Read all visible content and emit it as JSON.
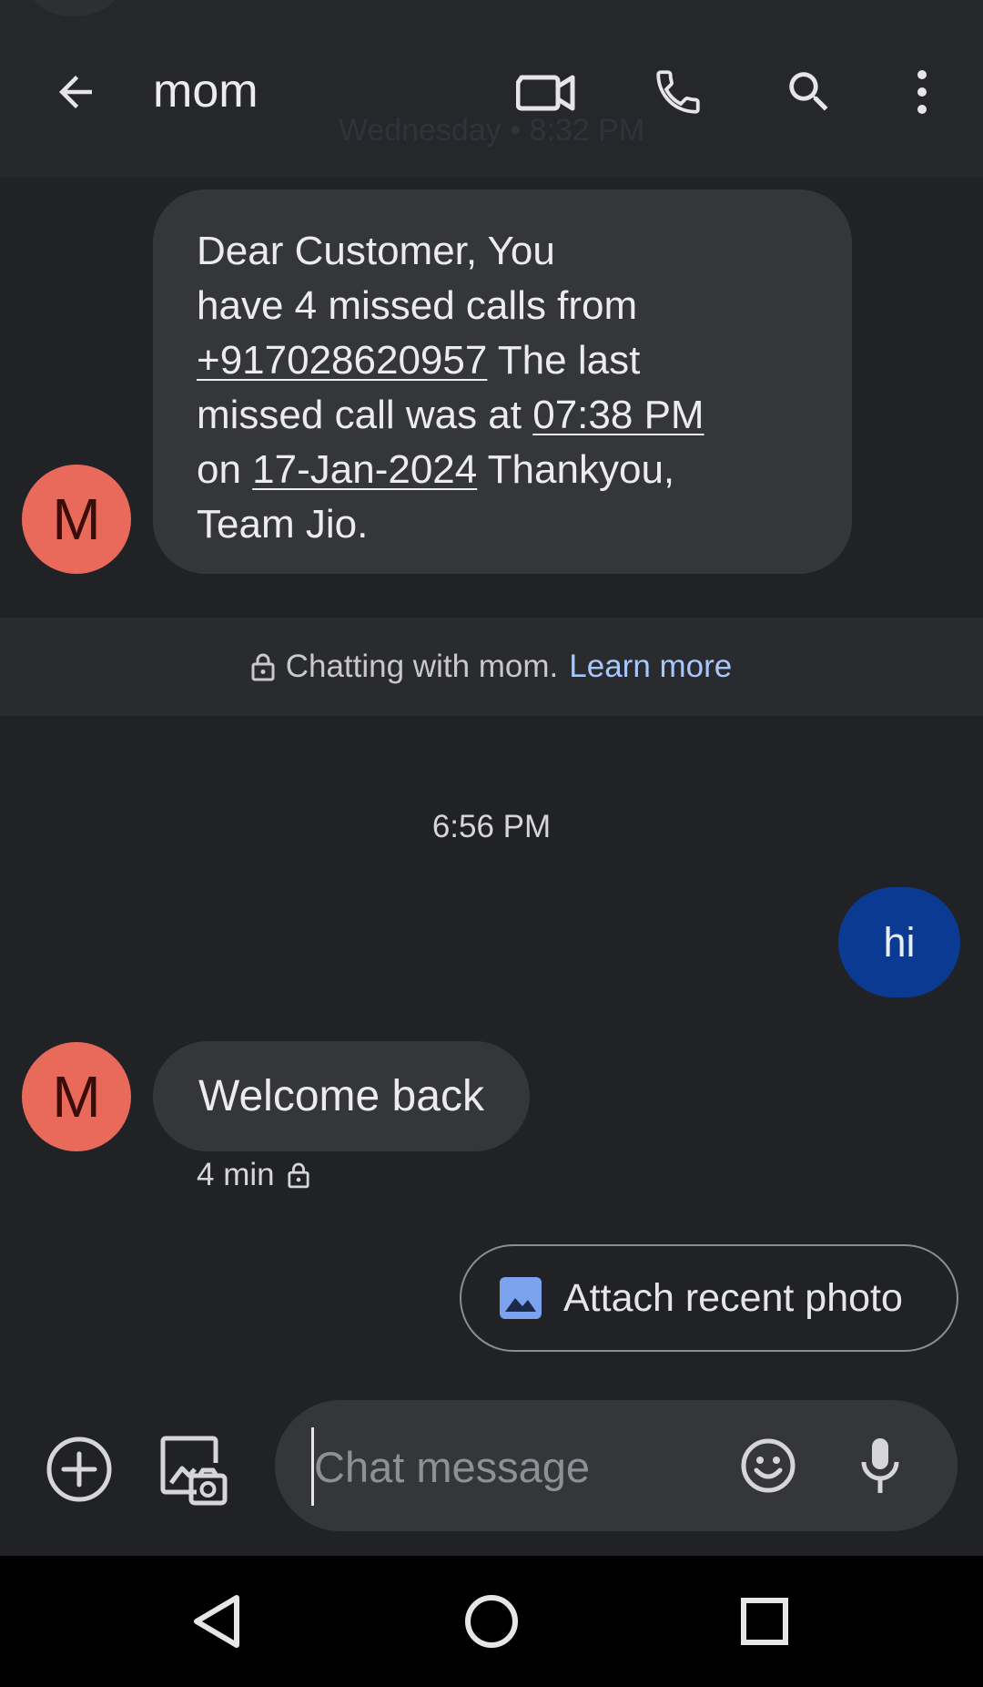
{
  "header": {
    "title": "mom",
    "ghost_date": "Wednesday • 8:32 PM",
    "icons": [
      "back-arrow-icon",
      "video-call-icon",
      "phone-icon",
      "search-icon",
      "more-vert-icon"
    ]
  },
  "messages": {
    "avatar_initial": "M",
    "first": {
      "line1": "Dear Customer, You",
      "line2": "have 4 missed calls from",
      "phone": "+917028620957",
      "after_phone": " The last",
      "line4_prefix": "missed call was at ",
      "time": "07:38 PM",
      "line5_prefix": "on ",
      "date": "17-Jan-2024",
      "line5_suffix": " Thankyou,",
      "line6": "Team Jio."
    },
    "banner_text": "Chatting with mom.",
    "banner_link": "Learn more",
    "timestamp": "6:56 PM",
    "outgoing": "hi",
    "incoming": "Welcome back",
    "incoming_meta": "4 min"
  },
  "suggestion": {
    "label": "Attach recent photo"
  },
  "composer": {
    "placeholder": "Chat message"
  },
  "colors": {
    "accent_link": "#a8c7fa",
    "outgoing_bubble": "#0b3a93",
    "avatar": "#e9695b"
  }
}
